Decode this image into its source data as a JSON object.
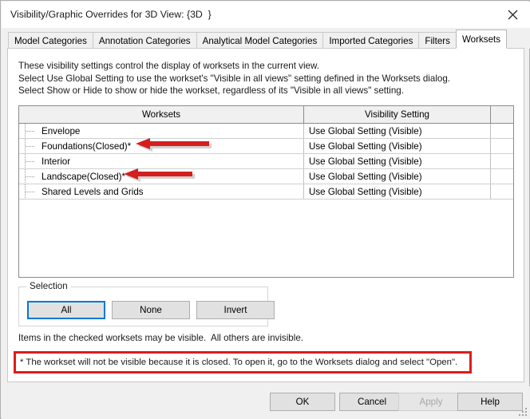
{
  "window": {
    "title": "Visibility/Graphic Overrides for 3D View: {3D  }",
    "close_icon": "close-icon"
  },
  "tabs": [
    {
      "label": "Model Categories",
      "active": false
    },
    {
      "label": "Annotation Categories",
      "active": false
    },
    {
      "label": "Analytical Model Categories",
      "active": false
    },
    {
      "label": "Imported Categories",
      "active": false
    },
    {
      "label": "Filters",
      "active": false
    },
    {
      "label": "Worksets",
      "active": true
    }
  ],
  "description": "These visibility settings control the display of worksets in the current view.\nSelect Use Global Setting to use the workset's \"Visible in all views\" setting defined in the Worksets dialog.\nSelect Show or Hide to show or hide the workset, regardless of its \"Visible in all views\" setting.",
  "table": {
    "headers": [
      "Worksets",
      "Visibility Setting",
      ""
    ],
    "rows": [
      {
        "workset": "Envelope",
        "visibility": "Use Global Setting (Visible)"
      },
      {
        "workset": "Foundations(Closed)*",
        "visibility": "Use Global Setting (Visible)"
      },
      {
        "workset": "Interior",
        "visibility": "Use Global Setting (Visible)"
      },
      {
        "workset": "Landscape(Closed)*",
        "visibility": "Use Global Setting (Visible)"
      },
      {
        "workset": "Shared Levels and Grids",
        "visibility": "Use Global Setting (Visible)"
      }
    ]
  },
  "selection": {
    "legend": "Selection",
    "all_label": "All",
    "none_label": "None",
    "invert_label": "Invert"
  },
  "note": "Items in the checked worksets may be visible.  All others are invisible.",
  "warning": {
    "text": "* The workset will not be visible because it is closed. To open it, go to the Worksets dialog and select \"Open\".",
    "border_color": "#e01b1b"
  },
  "footer": {
    "ok_label": "OK",
    "cancel_label": "Cancel",
    "apply_label": "Apply",
    "help_label": "Help"
  },
  "annotations": {
    "arrow_color": "#d41f1f",
    "arrows": [
      {
        "target_row": "Foundations(Closed)*",
        "direction": "left"
      },
      {
        "target_row": "Landscape(Closed)*",
        "direction": "left"
      }
    ]
  }
}
